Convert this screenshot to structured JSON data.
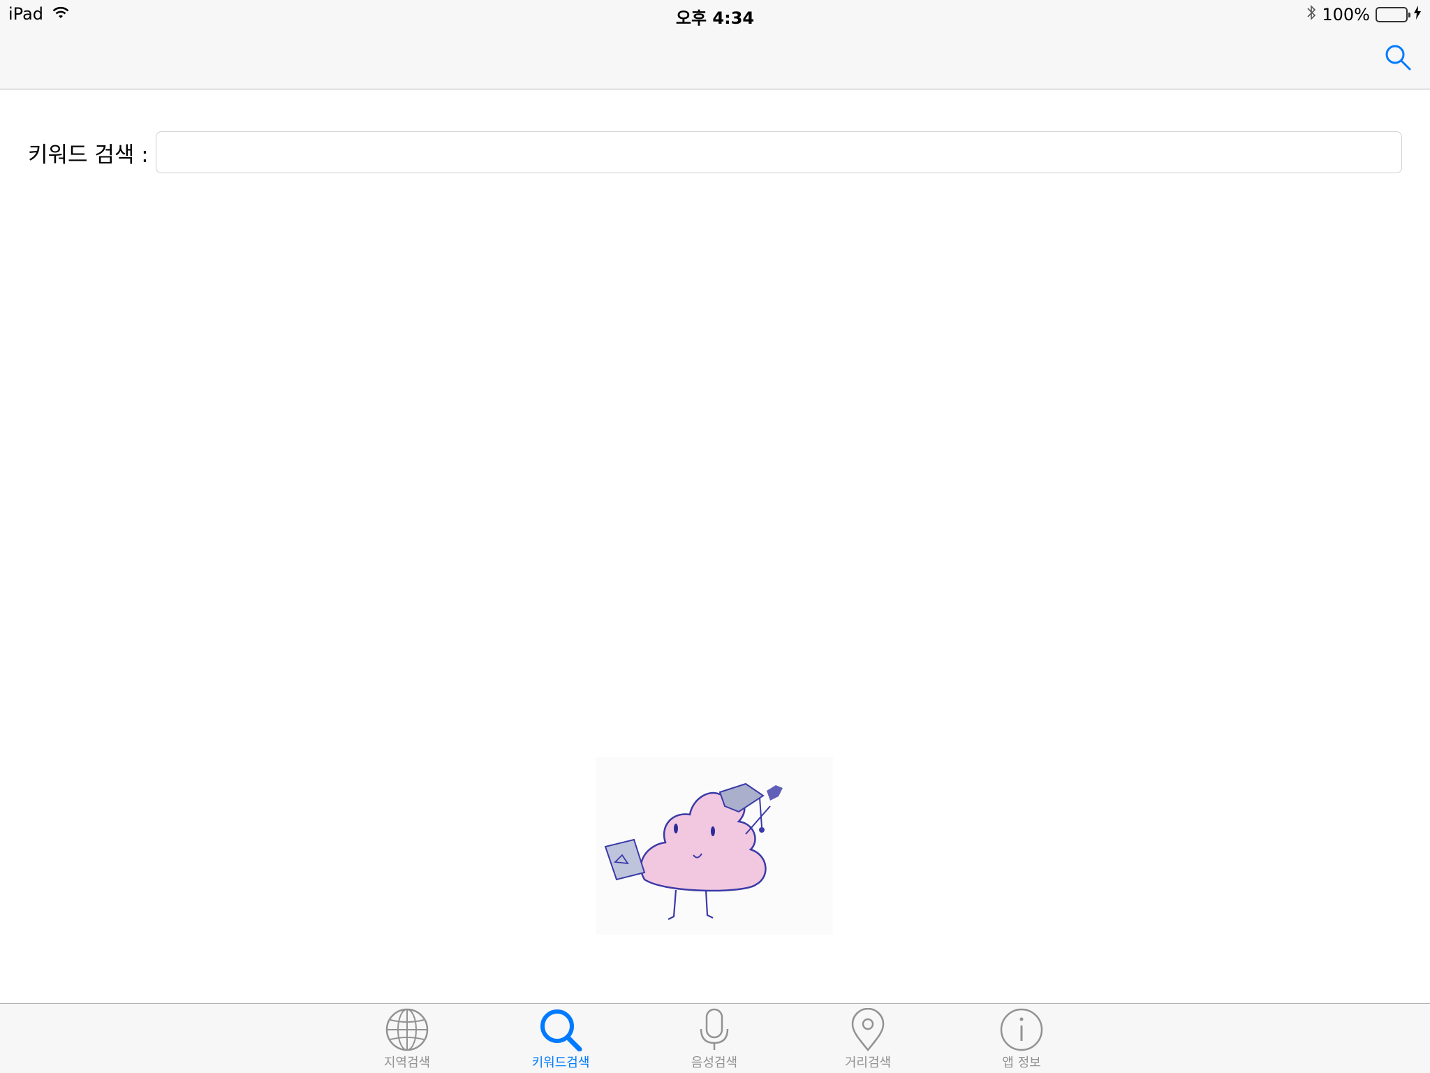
{
  "status_bar": {
    "device": "iPad",
    "time": "오후 4:34",
    "battery": "100%",
    "wifi_icon": "wifi-icon",
    "bluetooth_icon": "bluetooth-icon"
  },
  "nav_bar": {
    "search_icon": "search-icon"
  },
  "keyword_search": {
    "label": "키워드 검색 :",
    "value": "",
    "placeholder": ""
  },
  "tabs": [
    {
      "label": "지역검색",
      "icon": "globe-icon",
      "active": false
    },
    {
      "label": "키워드검색",
      "icon": "search-icon",
      "active": true
    },
    {
      "label": "음성검색",
      "icon": "microphone-icon",
      "active": false
    },
    {
      "label": "거리검색",
      "icon": "location-pin-icon",
      "active": false
    },
    {
      "label": "앱 정보",
      "icon": "info-icon",
      "active": false
    }
  ],
  "colors": {
    "accent": "#007aff",
    "inactive": "#929292",
    "battery": "#4cd964",
    "bar_background": "#f7f7f7"
  }
}
